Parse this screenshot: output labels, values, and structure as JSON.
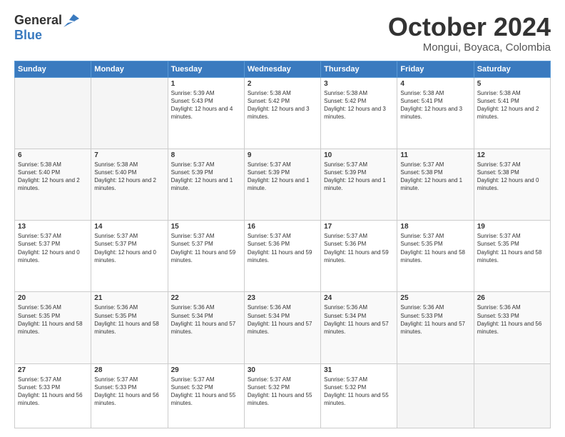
{
  "logo": {
    "general": "General",
    "blue": "Blue"
  },
  "title": "October 2024",
  "subtitle": "Mongui, Boyaca, Colombia",
  "days_of_week": [
    "Sunday",
    "Monday",
    "Tuesday",
    "Wednesday",
    "Thursday",
    "Friday",
    "Saturday"
  ],
  "weeks": [
    [
      {
        "day": "",
        "sunrise": "",
        "sunset": "",
        "daylight": ""
      },
      {
        "day": "",
        "sunrise": "",
        "sunset": "",
        "daylight": ""
      },
      {
        "day": "1",
        "sunrise": "Sunrise: 5:39 AM",
        "sunset": "Sunset: 5:43 PM",
        "daylight": "Daylight: 12 hours and 4 minutes."
      },
      {
        "day": "2",
        "sunrise": "Sunrise: 5:38 AM",
        "sunset": "Sunset: 5:42 PM",
        "daylight": "Daylight: 12 hours and 3 minutes."
      },
      {
        "day": "3",
        "sunrise": "Sunrise: 5:38 AM",
        "sunset": "Sunset: 5:42 PM",
        "daylight": "Daylight: 12 hours and 3 minutes."
      },
      {
        "day": "4",
        "sunrise": "Sunrise: 5:38 AM",
        "sunset": "Sunset: 5:41 PM",
        "daylight": "Daylight: 12 hours and 3 minutes."
      },
      {
        "day": "5",
        "sunrise": "Sunrise: 5:38 AM",
        "sunset": "Sunset: 5:41 PM",
        "daylight": "Daylight: 12 hours and 2 minutes."
      }
    ],
    [
      {
        "day": "6",
        "sunrise": "Sunrise: 5:38 AM",
        "sunset": "Sunset: 5:40 PM",
        "daylight": "Daylight: 12 hours and 2 minutes."
      },
      {
        "day": "7",
        "sunrise": "Sunrise: 5:38 AM",
        "sunset": "Sunset: 5:40 PM",
        "daylight": "Daylight: 12 hours and 2 minutes."
      },
      {
        "day": "8",
        "sunrise": "Sunrise: 5:37 AM",
        "sunset": "Sunset: 5:39 PM",
        "daylight": "Daylight: 12 hours and 1 minute."
      },
      {
        "day": "9",
        "sunrise": "Sunrise: 5:37 AM",
        "sunset": "Sunset: 5:39 PM",
        "daylight": "Daylight: 12 hours and 1 minute."
      },
      {
        "day": "10",
        "sunrise": "Sunrise: 5:37 AM",
        "sunset": "Sunset: 5:39 PM",
        "daylight": "Daylight: 12 hours and 1 minute."
      },
      {
        "day": "11",
        "sunrise": "Sunrise: 5:37 AM",
        "sunset": "Sunset: 5:38 PM",
        "daylight": "Daylight: 12 hours and 1 minute."
      },
      {
        "day": "12",
        "sunrise": "Sunrise: 5:37 AM",
        "sunset": "Sunset: 5:38 PM",
        "daylight": "Daylight: 12 hours and 0 minutes."
      }
    ],
    [
      {
        "day": "13",
        "sunrise": "Sunrise: 5:37 AM",
        "sunset": "Sunset: 5:37 PM",
        "daylight": "Daylight: 12 hours and 0 minutes."
      },
      {
        "day": "14",
        "sunrise": "Sunrise: 5:37 AM",
        "sunset": "Sunset: 5:37 PM",
        "daylight": "Daylight: 12 hours and 0 minutes."
      },
      {
        "day": "15",
        "sunrise": "Sunrise: 5:37 AM",
        "sunset": "Sunset: 5:37 PM",
        "daylight": "Daylight: 11 hours and 59 minutes."
      },
      {
        "day": "16",
        "sunrise": "Sunrise: 5:37 AM",
        "sunset": "Sunset: 5:36 PM",
        "daylight": "Daylight: 11 hours and 59 minutes."
      },
      {
        "day": "17",
        "sunrise": "Sunrise: 5:37 AM",
        "sunset": "Sunset: 5:36 PM",
        "daylight": "Daylight: 11 hours and 59 minutes."
      },
      {
        "day": "18",
        "sunrise": "Sunrise: 5:37 AM",
        "sunset": "Sunset: 5:35 PM",
        "daylight": "Daylight: 11 hours and 58 minutes."
      },
      {
        "day": "19",
        "sunrise": "Sunrise: 5:37 AM",
        "sunset": "Sunset: 5:35 PM",
        "daylight": "Daylight: 11 hours and 58 minutes."
      }
    ],
    [
      {
        "day": "20",
        "sunrise": "Sunrise: 5:36 AM",
        "sunset": "Sunset: 5:35 PM",
        "daylight": "Daylight: 11 hours and 58 minutes."
      },
      {
        "day": "21",
        "sunrise": "Sunrise: 5:36 AM",
        "sunset": "Sunset: 5:35 PM",
        "daylight": "Daylight: 11 hours and 58 minutes."
      },
      {
        "day": "22",
        "sunrise": "Sunrise: 5:36 AM",
        "sunset": "Sunset: 5:34 PM",
        "daylight": "Daylight: 11 hours and 57 minutes."
      },
      {
        "day": "23",
        "sunrise": "Sunrise: 5:36 AM",
        "sunset": "Sunset: 5:34 PM",
        "daylight": "Daylight: 11 hours and 57 minutes."
      },
      {
        "day": "24",
        "sunrise": "Sunrise: 5:36 AM",
        "sunset": "Sunset: 5:34 PM",
        "daylight": "Daylight: 11 hours and 57 minutes."
      },
      {
        "day": "25",
        "sunrise": "Sunrise: 5:36 AM",
        "sunset": "Sunset: 5:33 PM",
        "daylight": "Daylight: 11 hours and 57 minutes."
      },
      {
        "day": "26",
        "sunrise": "Sunrise: 5:36 AM",
        "sunset": "Sunset: 5:33 PM",
        "daylight": "Daylight: 11 hours and 56 minutes."
      }
    ],
    [
      {
        "day": "27",
        "sunrise": "Sunrise: 5:37 AM",
        "sunset": "Sunset: 5:33 PM",
        "daylight": "Daylight: 11 hours and 56 minutes."
      },
      {
        "day": "28",
        "sunrise": "Sunrise: 5:37 AM",
        "sunset": "Sunset: 5:33 PM",
        "daylight": "Daylight: 11 hours and 56 minutes."
      },
      {
        "day": "29",
        "sunrise": "Sunrise: 5:37 AM",
        "sunset": "Sunset: 5:32 PM",
        "daylight": "Daylight: 11 hours and 55 minutes."
      },
      {
        "day": "30",
        "sunrise": "Sunrise: 5:37 AM",
        "sunset": "Sunset: 5:32 PM",
        "daylight": "Daylight: 11 hours and 55 minutes."
      },
      {
        "day": "31",
        "sunrise": "Sunrise: 5:37 AM",
        "sunset": "Sunset: 5:32 PM",
        "daylight": "Daylight: 11 hours and 55 minutes."
      },
      {
        "day": "",
        "sunrise": "",
        "sunset": "",
        "daylight": ""
      },
      {
        "day": "",
        "sunrise": "",
        "sunset": "",
        "daylight": ""
      }
    ]
  ]
}
